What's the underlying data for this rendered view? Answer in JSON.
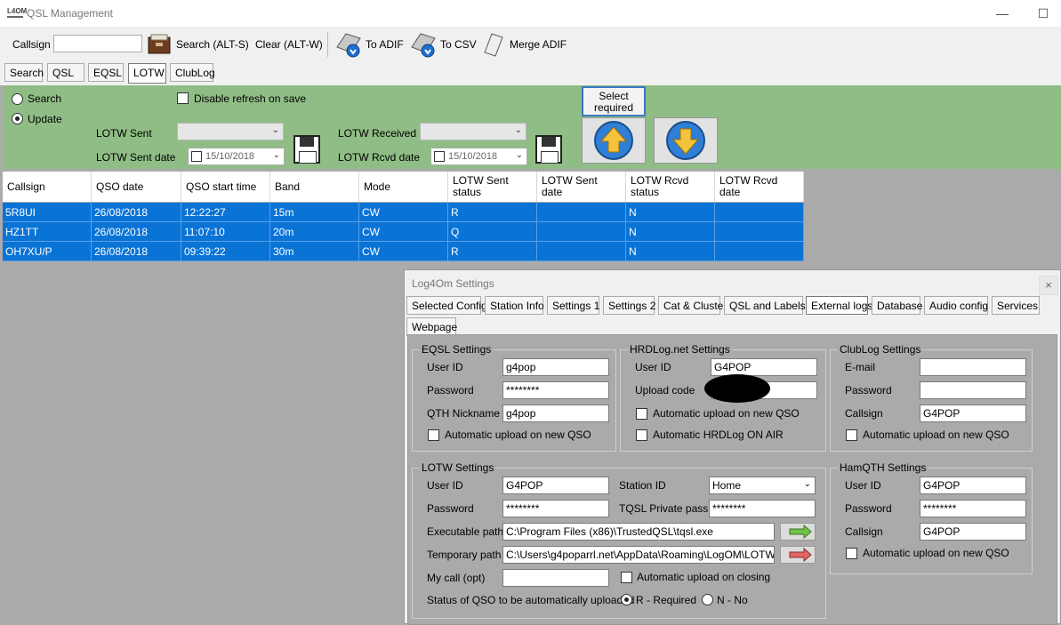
{
  "window": {
    "title": "QSL Management",
    "minimize": "—",
    "maximize": "☐"
  },
  "toolbar": {
    "callsign_label": "Callsign",
    "callsign_value": "",
    "search": "Search (ALT-S)",
    "clear": "Clear (ALT-W)",
    "to_adif": "To ADIF",
    "to_csv": "To CSV",
    "merge_adif": "Merge ADIF"
  },
  "tabs": [
    "Search",
    "QSL",
    "EQSL",
    "LOTW",
    "ClubLog"
  ],
  "active_tab": "LOTW",
  "lotw_panel": {
    "mode_search": "Search",
    "mode_update": "Update",
    "disable_refresh": "Disable refresh on save",
    "sent_label": "LOTW Sent",
    "sent_date_label": "LOTW Sent date",
    "sent_date": "15/10/2018",
    "received_label": "LOTW Received",
    "rcvd_date_label": "LOTW Rcvd date",
    "rcvd_date": "15/10/2018",
    "select_required": [
      "Select",
      "required"
    ]
  },
  "grid": {
    "columns": [
      [
        "Callsign"
      ],
      [
        "QSO date"
      ],
      [
        "QSO start time"
      ],
      [
        "Band"
      ],
      [
        "Mode"
      ],
      [
        "LOTW Sent",
        "status"
      ],
      [
        "LOTW Sent",
        "date"
      ],
      [
        "LOTW Rcvd",
        "status"
      ],
      [
        "LOTW Rcvd",
        "date"
      ]
    ],
    "rows": [
      [
        "5R8UI",
        "26/08/2018",
        "12:22:27",
        "15m",
        "CW",
        "R",
        "",
        "N",
        ""
      ],
      [
        "HZ1TT",
        "26/08/2018",
        "11:07:10",
        "20m",
        "CW",
        "Q",
        "",
        "N",
        ""
      ],
      [
        "OH7XU/P",
        "26/08/2018",
        "09:39:22",
        "30m",
        "CW",
        "R",
        "",
        "N",
        ""
      ]
    ]
  },
  "settings_dialog": {
    "title": "Log4Om Settings",
    "close": "×",
    "tabs": [
      "Selected Config",
      "Station Info",
      "Settings 1",
      "Settings 2",
      "Cat & Cluster",
      "QSL and Labels",
      "External logs",
      "Database",
      "Audio config",
      "Services",
      "Webpage"
    ],
    "active_tab": "External logs",
    "eqsl": {
      "title": "EQSL Settings",
      "user_id_label": "User ID",
      "user_id": "g4pop",
      "password_label": "Password",
      "password": "********",
      "qth_label": "QTH Nickname",
      "qth": "g4pop",
      "auto_upload": "Automatic upload on new QSO"
    },
    "hrdlog": {
      "title": "HRDLog.net Settings",
      "user_id_label": "User ID",
      "user_id": "G4POP",
      "upload_code_label": "Upload code",
      "upload_code": "",
      "auto_upload": "Automatic upload on new QSO",
      "auto_onair": "Automatic HRDLog ON AIR"
    },
    "clublog": {
      "title": "ClubLog Settings",
      "email_label": "E-mail",
      "email": "",
      "password_label": "Password",
      "password": "",
      "callsign_label": "Callsign",
      "callsign": "G4POP",
      "auto_upload": "Automatic upload on new QSO"
    },
    "lotw": {
      "title": "LOTW Settings",
      "user_id_label": "User ID",
      "user_id": "G4POP",
      "password_label": "Password",
      "password": "********",
      "station_id_label": "Station ID",
      "station_id": "Home",
      "tqsl_pass_label": "TQSL Private pass",
      "tqsl_pass": "********",
      "exec_label": "Executable path",
      "exec_path": "C:\\Program Files (x86)\\TrustedQSL\\tqsl.exe",
      "temp_label": "Temporary path",
      "temp_path": "C:\\Users\\g4poparrl.net\\AppData\\Roaming\\LogOM\\LOTW",
      "mycall_label": "My call (opt)",
      "mycall": "",
      "auto_closing": "Automatic upload on closing",
      "status_label": "Status of QSO to be automatically uploaded",
      "required": "R - Required",
      "no": "N - No"
    },
    "hamqth": {
      "title": "HamQTH Settings",
      "user_id_label": "User ID",
      "user_id": "G4POP",
      "password_label": "Password",
      "password": "********",
      "callsign_label": "Callsign",
      "callsign": "G4POP",
      "auto_upload": "Automatic upload on new QSO"
    }
  },
  "colors": {
    "accent_green": "#8fbd85",
    "row_selected": "#0a73d6"
  }
}
